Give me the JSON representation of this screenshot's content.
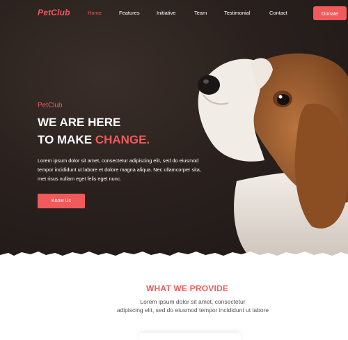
{
  "brand": {
    "logo_text": "PetClub"
  },
  "nav": {
    "items": [
      {
        "label": "Home",
        "active": true
      },
      {
        "label": "Features",
        "active": false
      },
      {
        "label": "Initiative",
        "active": false
      },
      {
        "label": "Team",
        "active": false
      },
      {
        "label": "Testimonial",
        "active": false
      },
      {
        "label": "Contact",
        "active": false
      }
    ],
    "donate_label": "Donate"
  },
  "hero": {
    "kicker": "PetClub",
    "headline_line1": "WE ARE HERE",
    "headline_line2_prefix": "TO MAKE ",
    "headline_line2_accent": "CHANGE.",
    "body_line1": "Lorem ipsum dolor sit amet, consectetur adipiscing elit, sed do eiusmod",
    "body_line2": "tempor incididunt ut labore et dolore magna aliqua. Nec ullamcorper sita,",
    "body_line3": "met risus nullam eget felis eget nunc.",
    "cta_label": "Know Us"
  },
  "services": {
    "title": "WHAT WE PROVIDE",
    "subtitle_line1": "Lorem ipsum dolor sit amet, consectetur",
    "subtitle_line2": "adipiscing elit, sed do eiusmod tempor incididunt ut labore"
  },
  "colors": {
    "accent": "#f05a5a",
    "hero_bg": "#2a211e",
    "text_light": "#ffffff",
    "text_muted": "#555555"
  }
}
